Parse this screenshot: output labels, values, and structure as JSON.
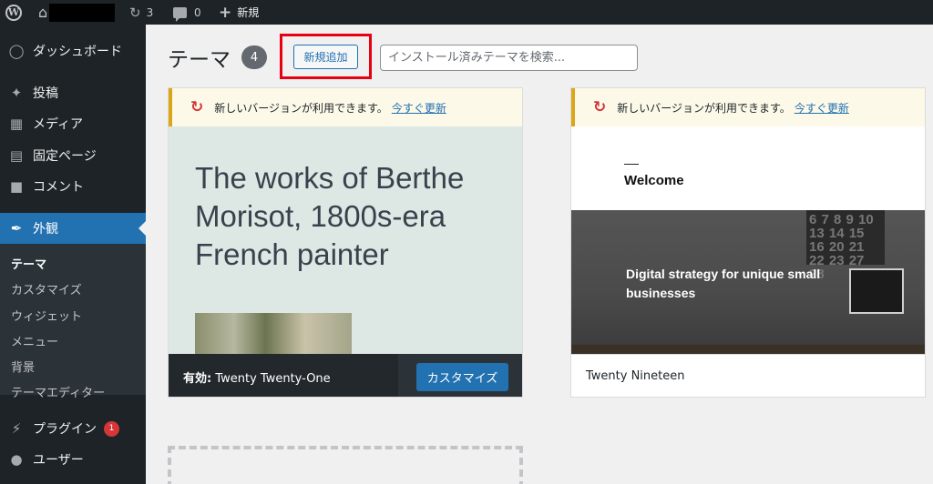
{
  "adminbar": {
    "wp_logo": "W",
    "home_icon": "home-icon",
    "updates_count": "3",
    "comments_count": "0",
    "new_label": "新規"
  },
  "sidebar": {
    "dashboard": "ダッシュボード",
    "posts": "投稿",
    "media": "メディア",
    "pages": "固定ページ",
    "comments": "コメント",
    "appearance": "外観",
    "submenu": [
      "テーマ",
      "カスタマイズ",
      "ウィジェット",
      "メニュー",
      "背景",
      "テーマエディター"
    ],
    "plugins": "プラグイン",
    "plugins_badge": "1",
    "users": "ユーザー"
  },
  "header": {
    "title": "テーマ",
    "count": "4",
    "add_new": "新規追加",
    "search_placeholder": "インストール済みテーマを検索..."
  },
  "themes": [
    {
      "notice_text": "新しいバージョンが利用できます。",
      "notice_link": "今すぐ更新",
      "screenshot_headline": "The works of Berthe Morisot, 1800s-era French painter",
      "active_prefix": "有効:",
      "name": "Twenty Twenty-One",
      "customize_label": "カスタマイズ"
    },
    {
      "notice_text": "新しいバージョンが利用できます。",
      "notice_link": "今すぐ更新",
      "screenshot_welcome": "Welcome",
      "screenshot_tagline": "Digital strategy for unique small businesses",
      "screenshot_calendar": "6 7 8 9 10 13 14 15 16 20 21 22 23 27 28",
      "name": "Twenty Nineteen"
    }
  ],
  "colors": {
    "accent": "#2271b1",
    "adminbar": "#1d2327",
    "highlight": "#e60012",
    "notice_border": "#dba617",
    "badge_red": "#d63638"
  }
}
